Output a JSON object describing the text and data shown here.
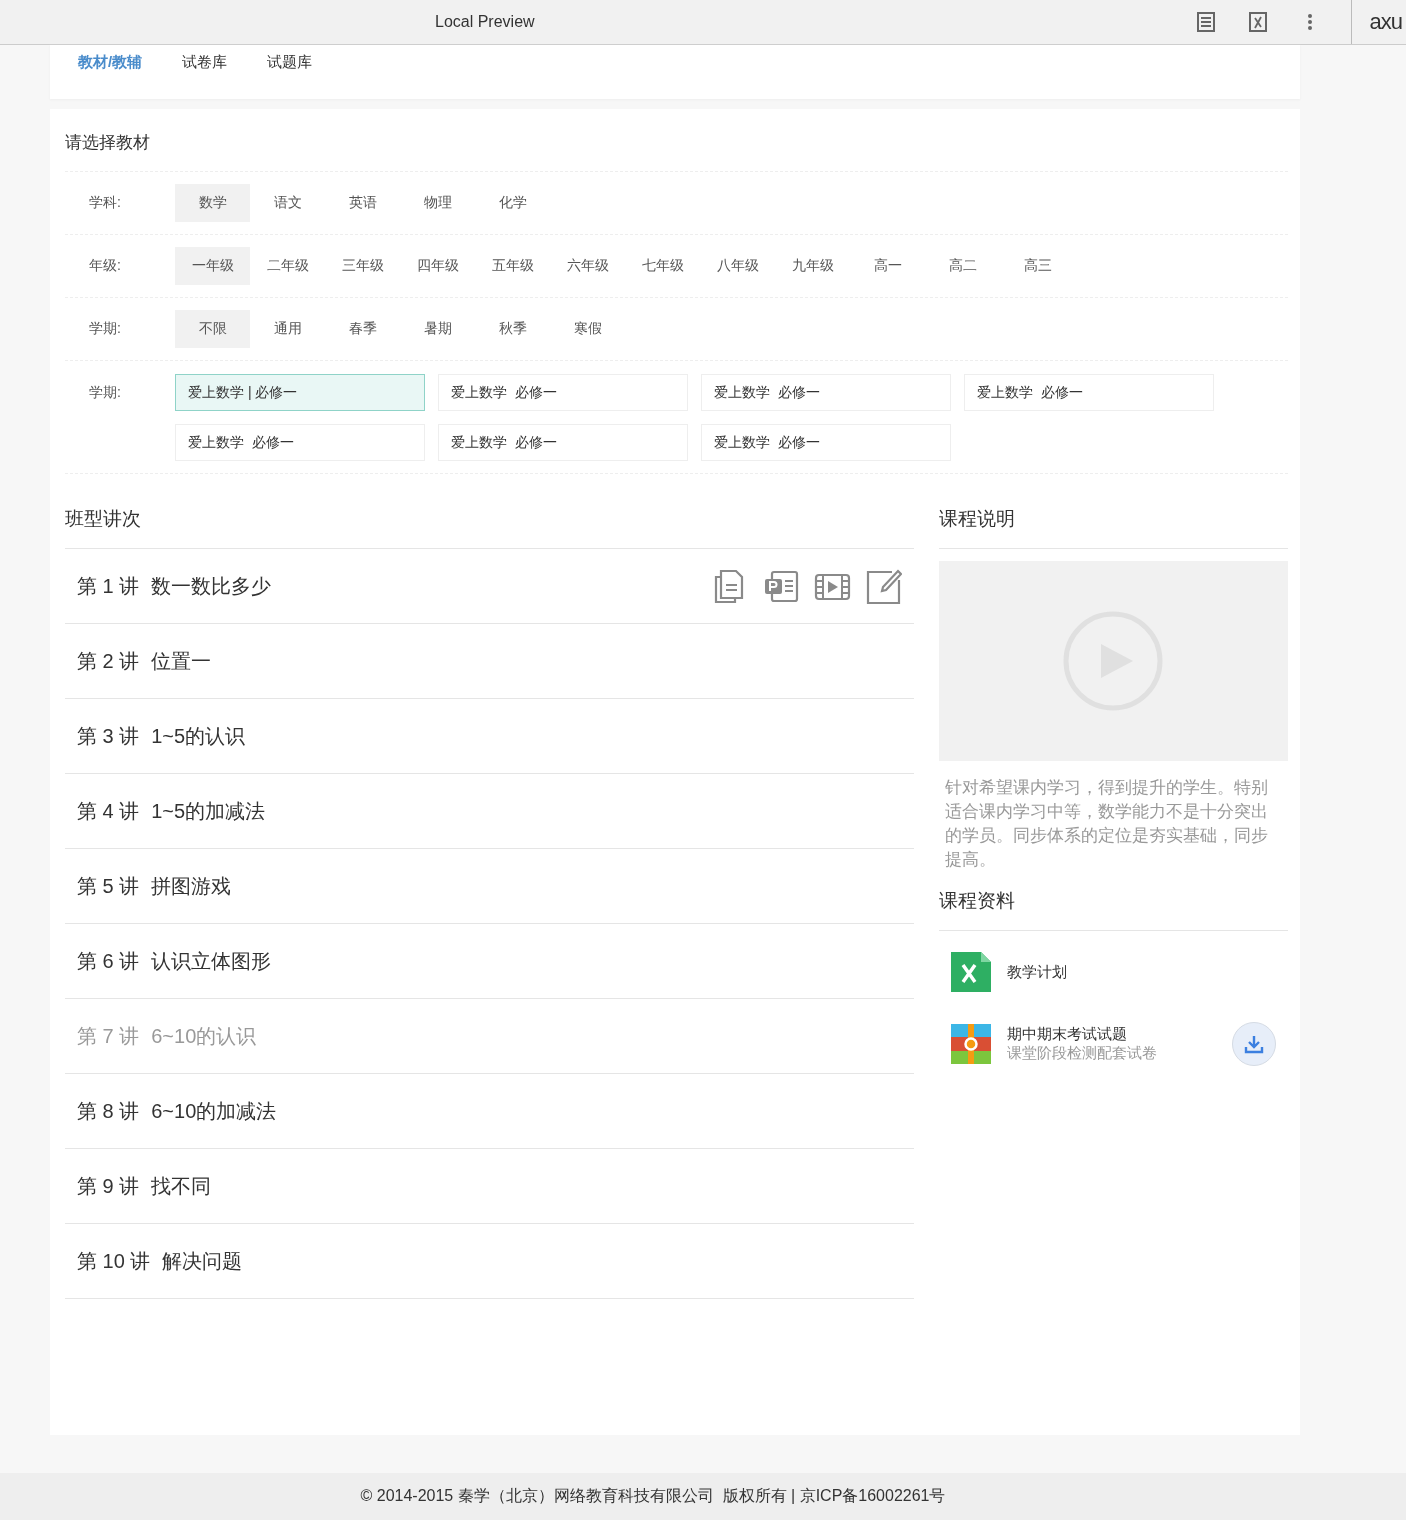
{
  "browser_bar": {
    "title": "Local Preview",
    "logo": "axu"
  },
  "nav_tabs": [
    {
      "label": "教材/教辅",
      "selected": true
    },
    {
      "label": "试卷库",
      "selected": false
    },
    {
      "label": "试题库",
      "selected": false
    }
  ],
  "picker": {
    "title": "请选择教材",
    "filters": [
      {
        "label": "学科:",
        "options": [
          {
            "label": "数学",
            "selected": true
          },
          {
            "label": "语文",
            "selected": false
          },
          {
            "label": "英语",
            "selected": false
          },
          {
            "label": "物理",
            "selected": false
          },
          {
            "label": "化学",
            "selected": false
          }
        ]
      },
      {
        "label": "年级:",
        "options": [
          {
            "label": "一年级",
            "selected": true
          },
          {
            "label": "二年级",
            "selected": false
          },
          {
            "label": "三年级",
            "selected": false
          },
          {
            "label": "四年级",
            "selected": false
          },
          {
            "label": "五年级",
            "selected": false
          },
          {
            "label": "六年级",
            "selected": false
          },
          {
            "label": "七年级",
            "selected": false
          },
          {
            "label": "八年级",
            "selected": false
          },
          {
            "label": "九年级",
            "selected": false
          },
          {
            "label": "高一",
            "selected": false
          },
          {
            "label": "高二",
            "selected": false
          },
          {
            "label": "高三",
            "selected": false
          }
        ]
      },
      {
        "label": "学期:",
        "options": [
          {
            "label": "不限",
            "selected": true
          },
          {
            "label": "通用",
            "selected": false
          },
          {
            "label": "春季",
            "selected": false
          },
          {
            "label": "暑期",
            "selected": false
          },
          {
            "label": "秋季",
            "selected": false
          },
          {
            "label": "寒假",
            "selected": false
          }
        ]
      }
    ],
    "books": {
      "label": "学期:",
      "options": [
        {
          "label": "爱上数学 | 必修一",
          "selected": true
        },
        {
          "label": "爱上数学  必修一",
          "selected": false
        },
        {
          "label": "爱上数学  必修一",
          "selected": false
        },
        {
          "label": "爱上数学  必修一",
          "selected": false
        },
        {
          "label": "爱上数学  必修一",
          "selected": false
        },
        {
          "label": "爱上数学  必修一",
          "selected": false
        },
        {
          "label": "爱上数学  必修一",
          "selected": false
        }
      ]
    }
  },
  "lessons": {
    "title": "班型讲次",
    "items": [
      {
        "number": "第 1 讲",
        "title": "数一数比多少",
        "disabled": false,
        "hovered": true
      },
      {
        "number": "第 2 讲",
        "title": "位置一",
        "disabled": false,
        "hovered": false
      },
      {
        "number": "第 3 讲",
        "title": "1~5的认识",
        "disabled": false,
        "hovered": false
      },
      {
        "number": "第 4 讲",
        "title": "1~5的加减法",
        "disabled": false,
        "hovered": false
      },
      {
        "number": "第 5 讲",
        "title": "拼图游戏",
        "disabled": false,
        "hovered": false
      },
      {
        "number": "第 6 讲",
        "title": "认识立体图形",
        "disabled": false,
        "hovered": false
      },
      {
        "number": "第 7 讲",
        "title": "6~10的认识",
        "disabled": true,
        "hovered": false
      },
      {
        "number": "第 8 讲",
        "title": "6~10的加减法",
        "disabled": false,
        "hovered": false
      },
      {
        "number": "第 9 讲",
        "title": "找不同",
        "disabled": false,
        "hovered": false
      },
      {
        "number": "第 10 讲",
        "title": "解决问题",
        "disabled": false,
        "hovered": false
      }
    ]
  },
  "course": {
    "title": "课程说明",
    "description": "针对希望课内学习，得到提升的学生。特别适合课内学习中等，数学能力不是十分突出的学员。同步体系的定位是夯实基础，同步提高。"
  },
  "materials": {
    "title": "课程资料",
    "items": [
      {
        "kind": "sheet",
        "name": "教学计划",
        "downloadable": false
      },
      {
        "kind": "archive",
        "name": "期中期末考试试题",
        "subtitle": "课堂阶段检测配套试卷",
        "downloadable": true
      }
    ]
  },
  "footer": "© 2014-2015 秦学（北京）网络教育科技有限公司  版权所有 | 京ICP备16002261号"
}
